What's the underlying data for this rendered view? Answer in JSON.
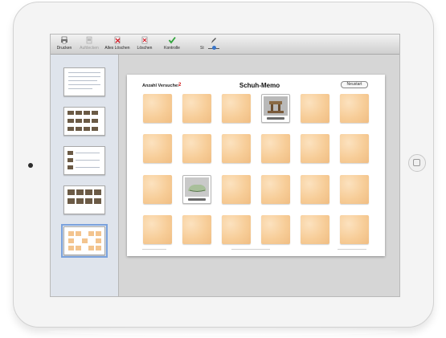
{
  "toolbar": {
    "items": [
      {
        "label": "Drucken",
        "icon": "printer-icon",
        "enabled": true
      },
      {
        "label": "Aufdecken",
        "icon": "reveal-icon",
        "enabled": false
      },
      {
        "label": "Alles Löschen",
        "icon": "clear-all-icon",
        "enabled": true
      },
      {
        "label": "Löschen",
        "icon": "delete-icon",
        "enabled": true
      },
      {
        "label": "Kontrolle",
        "icon": "check-icon",
        "enabled": true
      }
    ],
    "slider_label": "St"
  },
  "sidebar": {
    "page_count": 5,
    "selected_page": 5
  },
  "memo": {
    "attempts_label": "Anzahl Versuche:",
    "attempts_value": "2",
    "title": "Schuh-Memo",
    "restart_label": "Neustart",
    "rows": 4,
    "columns": 6,
    "flipped_cards": [
      {
        "row": 1,
        "column": 4,
        "subject": "wooden shoe last"
      },
      {
        "row": 3,
        "column": 2,
        "subject": "moccasin shoe"
      }
    ]
  },
  "colors": {
    "card_back": "#f7cd98",
    "attempts_value": "#d11a1a",
    "selected_thumb": "#7aa2dd"
  }
}
